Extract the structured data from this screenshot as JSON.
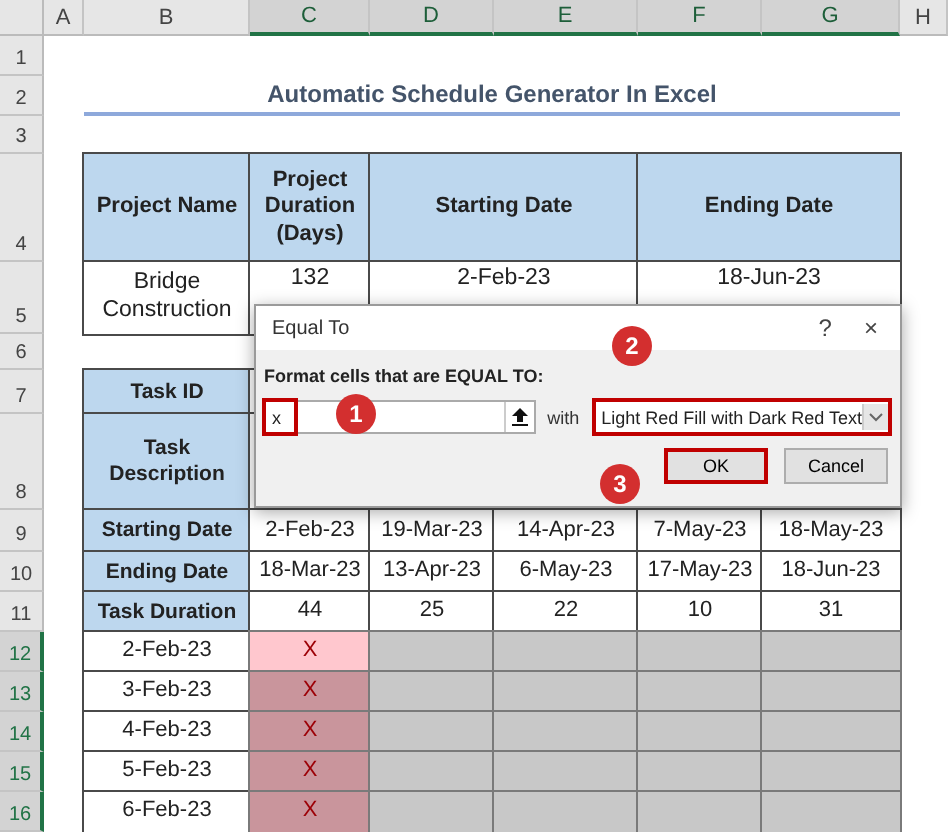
{
  "column_headers": [
    {
      "label": "A",
      "selected": false
    },
    {
      "label": "B",
      "selected": false
    },
    {
      "label": "C",
      "selected": true
    },
    {
      "label": "D",
      "selected": true
    },
    {
      "label": "E",
      "selected": true
    },
    {
      "label": "F",
      "selected": true
    },
    {
      "label": "G",
      "selected": true
    },
    {
      "label": "H",
      "selected": false
    }
  ],
  "row_headers": [
    {
      "label": "1",
      "selected": false
    },
    {
      "label": "2",
      "selected": false
    },
    {
      "label": "3",
      "selected": false
    },
    {
      "label": "4",
      "selected": false
    },
    {
      "label": "5",
      "selected": false
    },
    {
      "label": "6",
      "selected": false
    },
    {
      "label": "7",
      "selected": false
    },
    {
      "label": "8",
      "selected": false
    },
    {
      "label": "9",
      "selected": false
    },
    {
      "label": "10",
      "selected": false
    },
    {
      "label": "11",
      "selected": false
    },
    {
      "label": "12",
      "selected": true
    },
    {
      "label": "13",
      "selected": true
    },
    {
      "label": "14",
      "selected": true
    },
    {
      "label": "15",
      "selected": true
    },
    {
      "label": "16",
      "selected": true
    }
  ],
  "title": "Automatic Schedule Generator In Excel",
  "project_table": {
    "columns": [
      "Project Name",
      "Project Duration (Days)",
      "Starting Date",
      "Ending Date"
    ],
    "row": [
      "Bridge Construction",
      "132",
      "2-Feb-23",
      "18-Jun-23"
    ]
  },
  "task_table": [
    {
      "label": "Task ID"
    },
    {
      "label": "Task Description"
    },
    {
      "label": "Starting Date",
      "values": [
        "2-Feb-23",
        "19-Mar-23",
        "14-Apr-23",
        "7-May-23",
        "18-May-23"
      ]
    },
    {
      "label": "Ending Date",
      "values": [
        "18-Mar-23",
        "13-Apr-23",
        "6-May-23",
        "17-May-23",
        "18-Jun-23"
      ]
    },
    {
      "label": "Task Duration",
      "values": [
        "44",
        "25",
        "22",
        "10",
        "31"
      ]
    }
  ],
  "schedule": [
    {
      "date": "2-Feb-23",
      "cells": [
        {
          "value": "X",
          "color": "#ffc7ce"
        },
        {
          "color": "#c8c8c8"
        },
        {
          "color": "#c8c8c8"
        },
        {
          "color": "#c8c8c8"
        },
        {
          "color": "#c8c8c8"
        }
      ]
    },
    {
      "date": "3-Feb-23",
      "cells": [
        {
          "value": "X",
          "color": "#c9959c"
        },
        {
          "color": "#c8c8c8"
        },
        {
          "color": "#c8c8c8"
        },
        {
          "color": "#c8c8c8"
        },
        {
          "color": "#c8c8c8"
        }
      ]
    },
    {
      "date": "4-Feb-23",
      "cells": [
        {
          "value": "X",
          "color": "#c9959c"
        },
        {
          "color": "#c8c8c8"
        },
        {
          "color": "#c8c8c8"
        },
        {
          "color": "#c8c8c8"
        },
        {
          "color": "#c8c8c8"
        }
      ]
    },
    {
      "date": "5-Feb-23",
      "cells": [
        {
          "value": "X",
          "color": "#c9959c"
        },
        {
          "color": "#c8c8c8"
        },
        {
          "color": "#c8c8c8"
        },
        {
          "color": "#c8c8c8"
        },
        {
          "color": "#c8c8c8"
        }
      ]
    },
    {
      "date": "6-Feb-23",
      "cells": [
        {
          "value": "X",
          "color": "#c9959c"
        },
        {
          "color": "#c8c8c8"
        },
        {
          "color": "#c8c8c8"
        },
        {
          "color": "#c8c8c8"
        },
        {
          "color": "#c8c8c8"
        }
      ]
    }
  ],
  "dialog": {
    "title": "Equal To",
    "help": "?",
    "close": "×",
    "label": "Format cells that are EQUAL TO:",
    "value": "x",
    "with": "with",
    "format": "Light Red Fill with Dark Red Text",
    "buttons": [
      {
        "label": "OK",
        "selected": true
      },
      {
        "label": "Cancel",
        "selected": false
      }
    ],
    "steps": [
      "1",
      "2",
      "3"
    ]
  }
}
